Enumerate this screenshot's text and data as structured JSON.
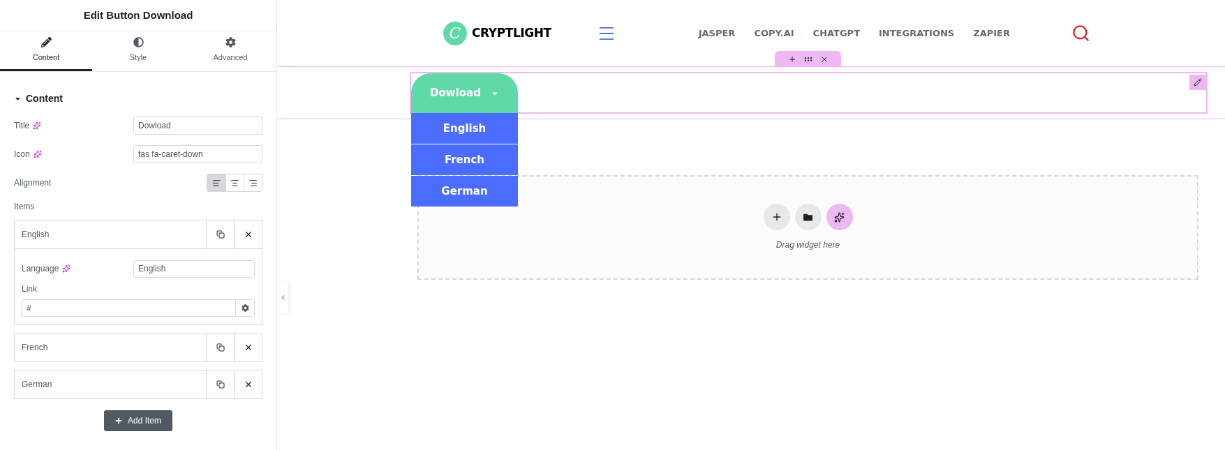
{
  "panel": {
    "title": "Edit Button Download",
    "tabs": [
      {
        "label": "Content",
        "kind": "pencil",
        "selected": true
      },
      {
        "label": "Style",
        "kind": "contrast",
        "selected": false
      },
      {
        "label": "Advanced",
        "kind": "gear",
        "selected": false
      }
    ],
    "section": {
      "title": "Content",
      "expanded": true
    },
    "fields": [
      {
        "label": "Title",
        "value": "Dowload"
      },
      {
        "label": "Icon",
        "value": "fas fa-caret-down"
      }
    ],
    "alignment": {
      "label": "Alignment",
      "options": [
        {
          "kind": "left",
          "selected": true
        },
        {
          "kind": "center",
          "selected": false
        },
        {
          "kind": "right",
          "selected": false
        }
      ]
    },
    "items_label": "Items",
    "items": [
      {
        "title": "English",
        "expanded": true,
        "language_label": "Language",
        "language_value": "English",
        "link_label": "Link",
        "link_value": "#"
      },
      {
        "title": "French",
        "expanded": false
      },
      {
        "title": "German",
        "expanded": false
      }
    ],
    "add_button": "Add Item"
  },
  "canvas": {
    "logo": {
      "letter": "C",
      "name": "CRYPTLIGHT"
    },
    "nav": [
      "JASPER",
      "COPY.AI",
      "CHATGPT",
      "INTEGRATIONS",
      "ZAPIER"
    ],
    "dropdown": {
      "label": "Dowload",
      "open": true,
      "items": [
        "English",
        "French",
        "German"
      ]
    },
    "drop_zone": {
      "hint": "Drag widget here"
    }
  }
}
